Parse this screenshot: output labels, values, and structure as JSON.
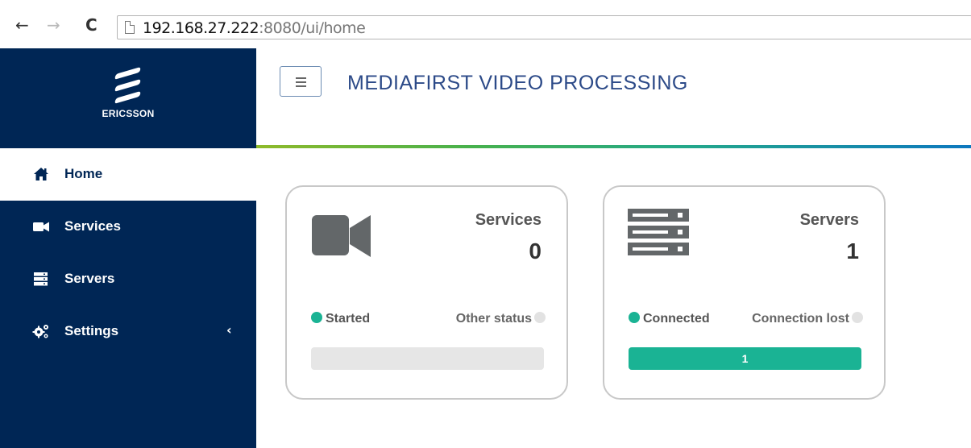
{
  "browser": {
    "url_host": "192.168.27.222",
    "url_rest": ":8080/ui/home"
  },
  "brand": {
    "name": "ERICSSON"
  },
  "header": {
    "title": "MEDIAFIRST VIDEO PROCESSING"
  },
  "sidebar": {
    "items": [
      {
        "label": "Home",
        "icon": "home-icon",
        "active": true
      },
      {
        "label": "Services",
        "icon": "video-camera-icon",
        "active": false
      },
      {
        "label": "Servers",
        "icon": "server-icon",
        "active": false
      },
      {
        "label": "Settings",
        "icon": "gears-icon",
        "active": false,
        "chevron": "‹"
      }
    ]
  },
  "cards": {
    "services": {
      "title": "Services",
      "count": "0",
      "status_left": "Started",
      "status_right": "Other status",
      "bar_value": "",
      "bar_fraction": 0
    },
    "servers": {
      "title": "Servers",
      "count": "1",
      "status_left": "Connected",
      "status_right": "Connection lost",
      "bar_value": "1",
      "bar_fraction": 1
    }
  },
  "colors": {
    "sidebar_bg": "#002655",
    "accent_green": "#1ab394",
    "title_color": "#2c4a88"
  }
}
